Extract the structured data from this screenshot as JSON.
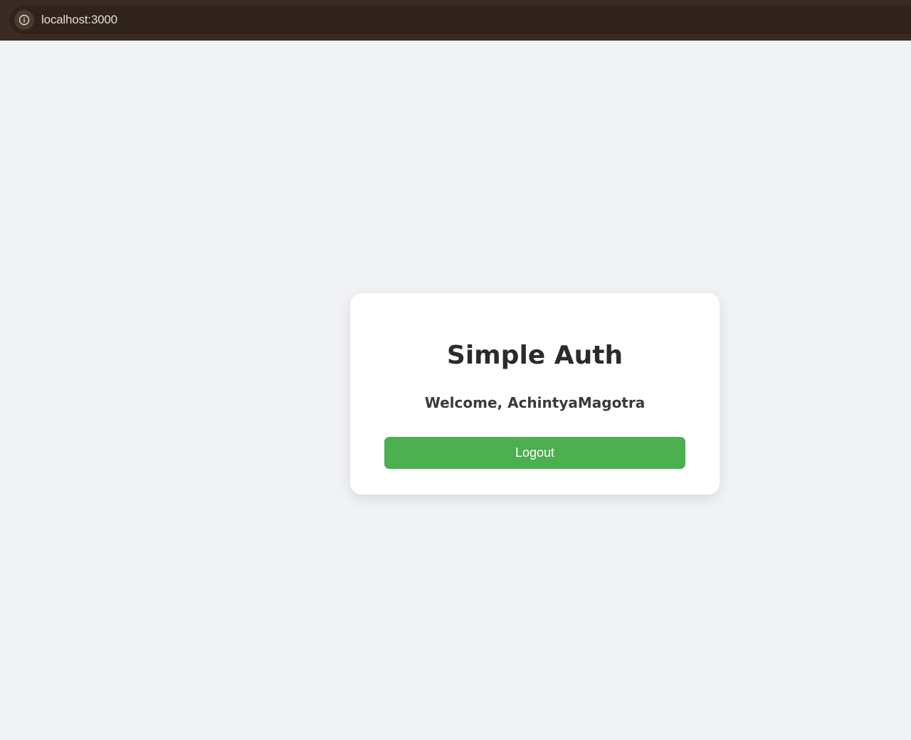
{
  "browser": {
    "url": "localhost:3000",
    "info_icon": "info-icon"
  },
  "card": {
    "title": "Simple Auth",
    "welcome": "Welcome, AchintyaMagotra",
    "logout_label": "Logout"
  },
  "colors": {
    "background": "#f0f2f5",
    "browser_bar": "#3b2a22",
    "card": "#ffffff",
    "button": "#4caf50",
    "title_text": "#2b2b2b"
  }
}
